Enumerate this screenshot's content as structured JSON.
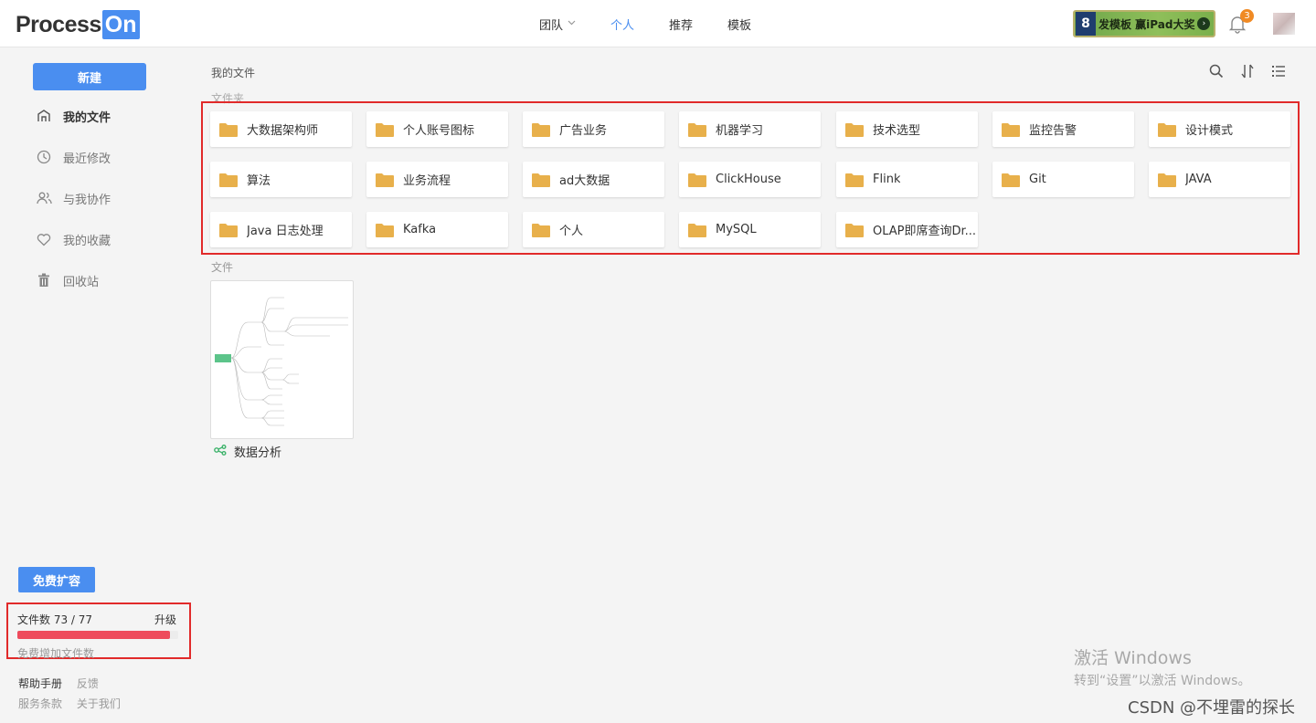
{
  "header": {
    "logo_text": "Process",
    "logo_badge": "On",
    "nav": [
      {
        "label": "团队",
        "has_dropdown": true
      },
      {
        "label": "个人",
        "active": true
      },
      {
        "label": "推荐"
      },
      {
        "label": "模板"
      }
    ],
    "promo_text": "发模板 赢iPad大奖",
    "notification_count": "3"
  },
  "sidebar": {
    "new_button": "新建",
    "items": [
      {
        "label": "我的文件",
        "icon": "home-icon",
        "active": true
      },
      {
        "label": "最近修改",
        "icon": "clock-icon"
      },
      {
        "label": "与我协作",
        "icon": "people-icon"
      },
      {
        "label": "我的收藏",
        "icon": "heart-icon"
      },
      {
        "label": "回收站",
        "icon": "trash-icon"
      }
    ],
    "expand_button": "免费扩容",
    "quota": {
      "label": "文件数 73 / 77",
      "used": 73,
      "total": 77,
      "upgrade": "升级",
      "add_more": "免费增加文件数"
    },
    "footer": {
      "help": "帮助手册",
      "feedback": "反馈",
      "terms": "服务条款",
      "about": "关于我们"
    }
  },
  "main": {
    "breadcrumb": "我的文件",
    "toolbar_icons": [
      "search-icon",
      "sort-icon",
      "list-view-icon"
    ],
    "folders_heading": "文件夹",
    "folders": [
      "大数据架构师",
      "个人账号图标",
      "广告业务",
      "机器学习",
      "技术选型",
      "监控告警",
      "设计模式",
      "算法",
      "业务流程",
      "ad大数据",
      "ClickHouse",
      "Flink",
      "Git",
      "JAVA",
      "Java 日志处理",
      "Kafka",
      "个人",
      "MySQL",
      "OLAP即席查询Dr..."
    ],
    "files_heading": "文件",
    "files": [
      {
        "name": "数据分析",
        "type_icon": "mindmap-icon"
      }
    ]
  },
  "overlay": {
    "activate_title": "激活 Windows",
    "activate_sub": "转到“设置”以激活 Windows。",
    "watermark": "CSDN @不埋雷的探长"
  },
  "colors": {
    "accent": "#4a8ef0",
    "folder": "#e8b04b",
    "highlight_border": "#e12a2a",
    "quota_bar": "#ee4b5c",
    "badge": "#f08a24"
  }
}
